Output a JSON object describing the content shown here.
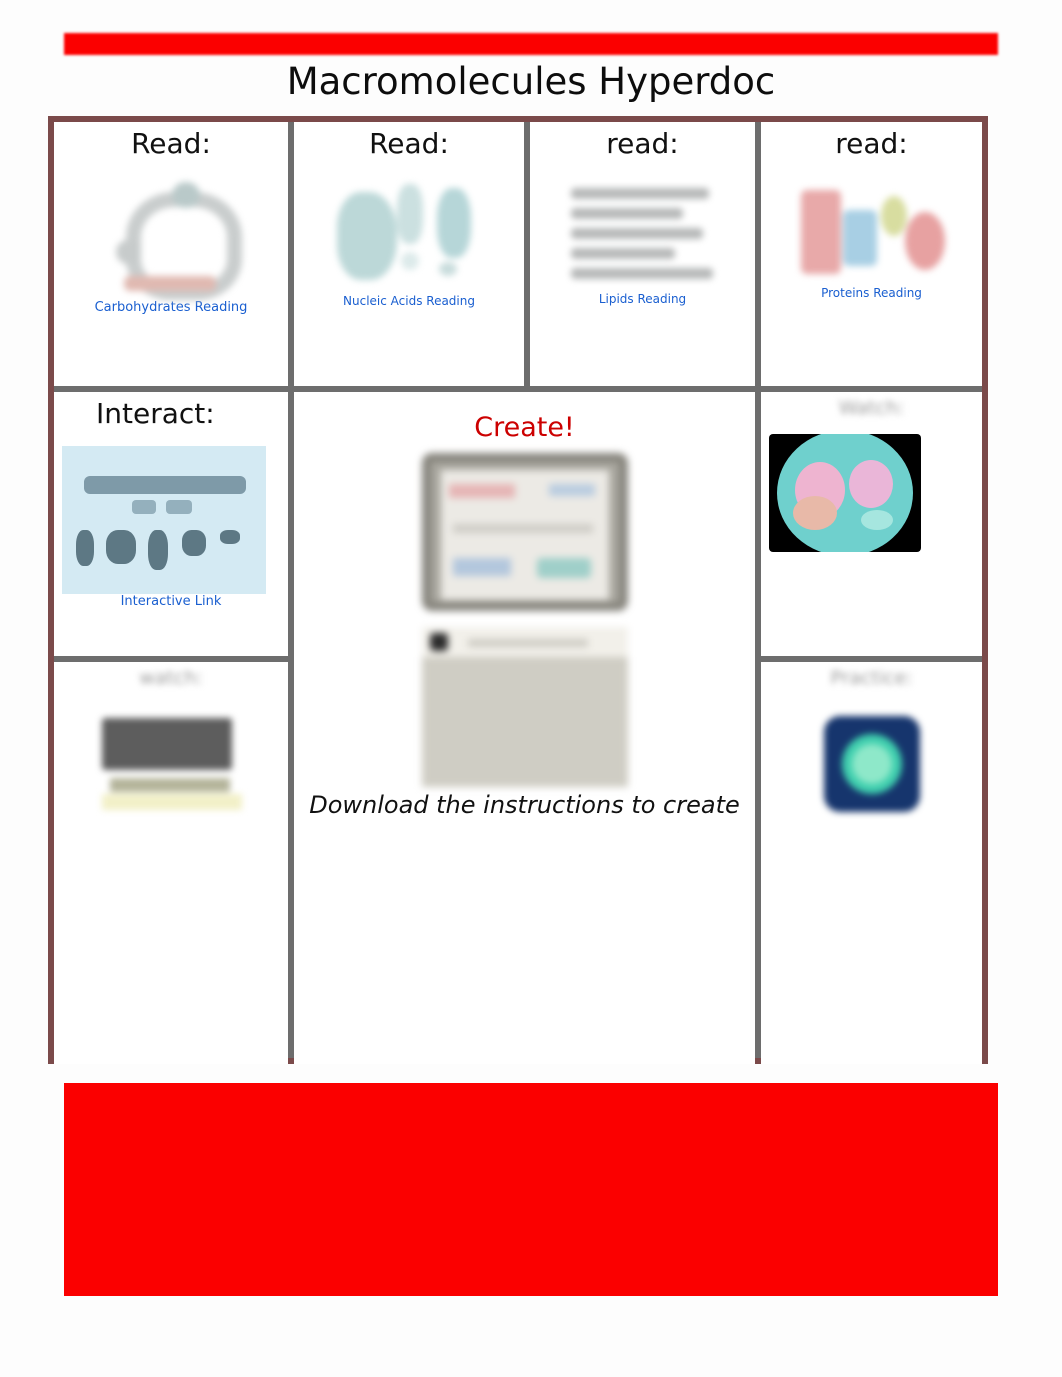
{
  "document": {
    "title": "Macromolecules Hyperdoc"
  },
  "colors": {
    "accent_red": "#FB0000",
    "link_blue": "#1A5FD0",
    "create_red": "#CC0000",
    "border_gray": "#6D6D6D"
  },
  "top_bar": {
    "label": ""
  },
  "grid": {
    "row1": [
      {
        "heading": "Read:",
        "link": "Carbohydrates Reading",
        "thumbnail": "carbohydrate-molecule-image"
      },
      {
        "heading": "Read:",
        "link": "Nucleic Acids Reading",
        "thumbnail": "nucleic-acids-image"
      },
      {
        "heading": "read:",
        "link": "Lipids Reading",
        "thumbnail": "lipids-article-image"
      },
      {
        "heading": "read:",
        "link": "Proteins Reading",
        "thumbnail": "proteins-diagram-image"
      }
    ],
    "row2": {
      "left": {
        "heading": "Interact:",
        "link": "Interactive Link",
        "thumbnail": "macromolecules-interactive-image"
      },
      "center": {
        "heading": "Create!",
        "caption": "Download the instructions to create",
        "bottom_link": "",
        "thumbnail_top": "create-instructions-screenshot-1",
        "thumbnail_bottom": "create-instructions-screenshot-2"
      },
      "right": {
        "heading": "Watch:",
        "link": "",
        "thumbnail": "macromolecules-video-thumbnail"
      }
    },
    "row3": {
      "left": {
        "heading": "watch:",
        "link": "",
        "thumbnail": "video-notes-thumbnail"
      },
      "right": {
        "heading": "Practice:",
        "link": "",
        "thumbnail": "practice-quiz-app-icon"
      }
    }
  },
  "bottom_block": {
    "label": ""
  }
}
